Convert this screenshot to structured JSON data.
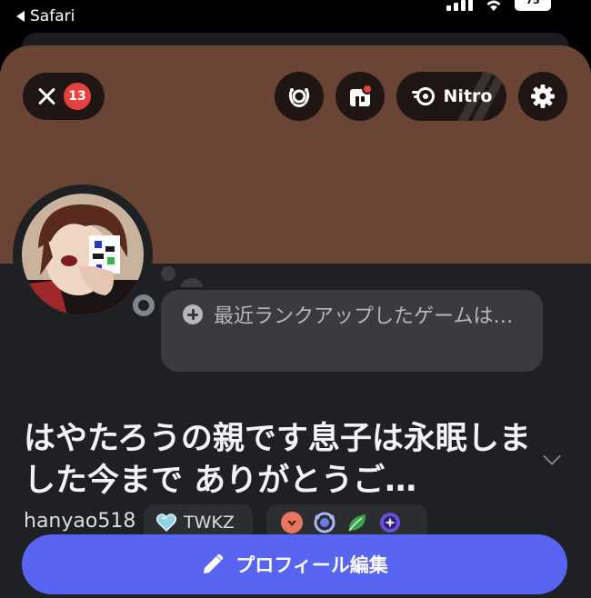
{
  "status_bar": {
    "back_label": "Safari",
    "battery": "75"
  },
  "header": {
    "notification_count": "13",
    "nitro_label": "Nitro"
  },
  "profile": {
    "status_placeholder": "最近ランクアップしたゲームは…",
    "display_name": "はやたろうの親です息子は永眠しました今まで ありがとうご…",
    "username": "hanyao518",
    "server_tag": "TWKZ",
    "badges": [
      "hypesquad-icon",
      "nitro-laurel-icon",
      "leaf-icon",
      "quest-icon"
    ],
    "edit_button_label": "プロフィール編集"
  },
  "colors": {
    "banner": "#6a4536",
    "accent": "#5865f2",
    "badge_red": "#e5413f"
  }
}
